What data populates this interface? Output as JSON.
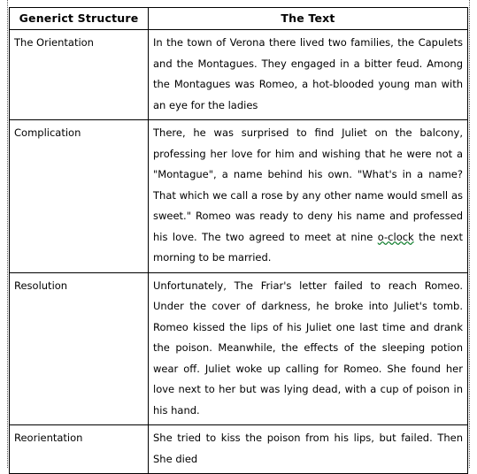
{
  "document": {
    "table": {
      "columns": [
        {
          "key": "structure",
          "header": "Generict Structure"
        },
        {
          "key": "text",
          "header": "The Text"
        }
      ],
      "rows": [
        {
          "structure": "The Orientation",
          "text": "In the town of Verona there lived two families, the Capulets and the Montagues. They engaged in a bitter feud. Among the Montagues was Romeo, a hot-blooded young man with an eye for the ladies"
        },
        {
          "structure": "Complication",
          "text_before_error": "There, he was surprised to find Juliet on the balcony, professing her love for him and wishing that he were not a \"Montague\", a name behind his own. \"What's in a name? That which we call a rose by any other name would smell as sweet.\" Romeo was ready to deny his name and professed his love. The two agreed to meet at nine ",
          "text_error": "o-clock",
          "text_after_error": " the next morning to be married."
        },
        {
          "structure": "Resolution",
          "text": "Unfortunately, The Friar's letter failed to reach Romeo. Under the cover of darkness, he broke into Juliet's tomb. Romeo kissed the lips of his Juliet one last time and drank the poison. Meanwhile, the effects of the sleeping potion wear off. Juliet woke up calling for Romeo. She found her love next to her but was lying dead, with a cup of poison in his hand."
        },
        {
          "structure": "Reorientation",
          "text": "She tried to kiss the poison from his lips, but failed. Then She died"
        }
      ]
    }
  },
  "colors": {
    "border": "#000000",
    "text": "#000000",
    "background": "#ffffff",
    "spellcheck_underline": "#0a7a28",
    "guide": "#555555"
  }
}
